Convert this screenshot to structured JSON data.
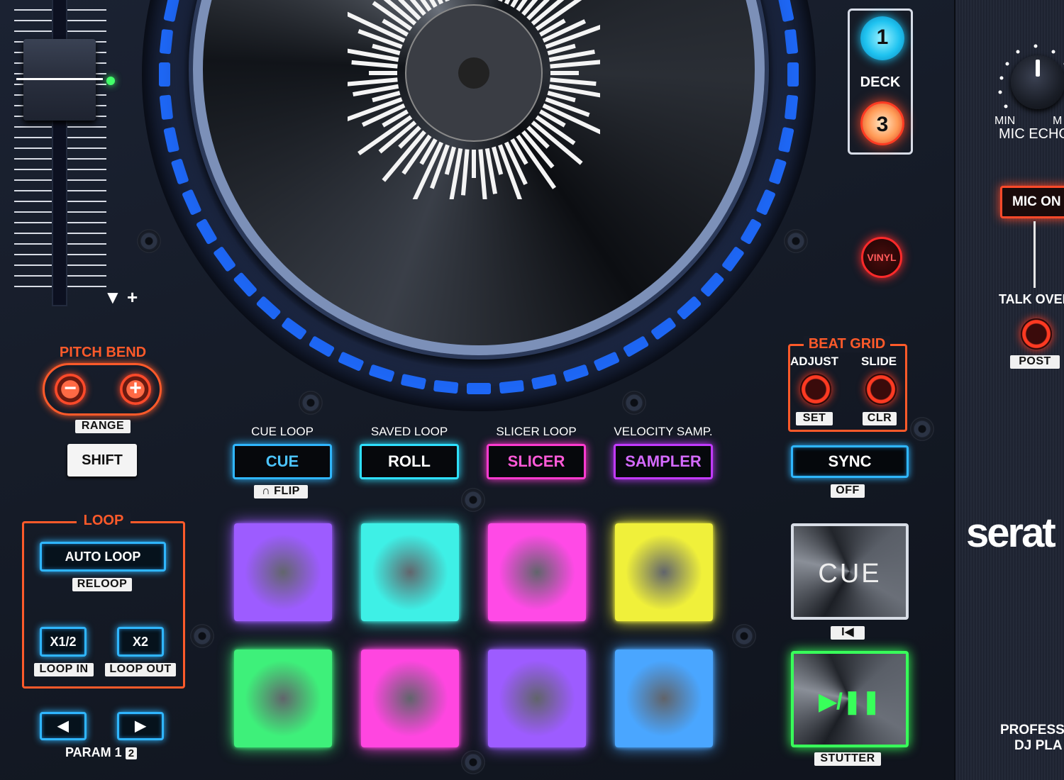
{
  "pitch_fader": {
    "marker": "▼ +"
  },
  "deck": {
    "label": "DECK",
    "deck_a": "1",
    "deck_b": "3"
  },
  "vinyl_label": "VINYL",
  "pitch_bend": {
    "title": "PITCH BEND",
    "minus": "−",
    "plus": "+",
    "range": "RANGE"
  },
  "shift_label": "SHIFT",
  "loop": {
    "title": "LOOP",
    "auto_loop": "AUTO LOOP",
    "reloop": "RELOOP",
    "half": "X1/2",
    "double": "X2",
    "loop_in": "LOOP IN",
    "loop_out": "LOOP OUT"
  },
  "param": {
    "label": "PARAM 1",
    "num": "2",
    "left": "◀",
    "right": "▶"
  },
  "modes": [
    {
      "top": "CUE LOOP",
      "label": "CUE",
      "color": "#2fb6ff",
      "text_color": "#4cc4ff"
    },
    {
      "top": "SAVED LOOP",
      "label": "ROLL",
      "color": "#2ee0ff",
      "text_color": "#ffffff"
    },
    {
      "top": "SLICER LOOP",
      "label": "SLICER",
      "color": "#ff3ad0",
      "text_color": "#ff5ad8"
    },
    {
      "top": "VELOCITY SAMP.",
      "label": "SAMPLER",
      "color": "#c23aff",
      "text_color": "#d46aff"
    }
  ],
  "flip_label": "FLIP",
  "pads": [
    {
      "color": "#9d5cff"
    },
    {
      "color": "#3ef0e6"
    },
    {
      "color": "#ff4ae6"
    },
    {
      "color": "#f0f03a"
    },
    {
      "color": "#3ef07a"
    },
    {
      "color": "#ff46e0"
    },
    {
      "color": "#9d5cff"
    },
    {
      "color": "#4aa6ff"
    }
  ],
  "beat_grid": {
    "title": "BEAT GRID",
    "adjust": "ADJUST",
    "slide": "SLIDE",
    "set": "SET",
    "clr": "CLR"
  },
  "sync": {
    "label": "SYNC",
    "off": "OFF"
  },
  "cue_big": "CUE",
  "cue_sub": "I◀",
  "play_big": "▶/❚❚",
  "stutter": "STUTTER",
  "mic": {
    "min": "MIN",
    "max": "M",
    "echo": "MIC ECHO",
    "on": "MIC ON",
    "talk": "TALK OVER",
    "post": "POST"
  },
  "brand": "serat",
  "footer_1": "PROFESS",
  "footer_2": "DJ PLA"
}
